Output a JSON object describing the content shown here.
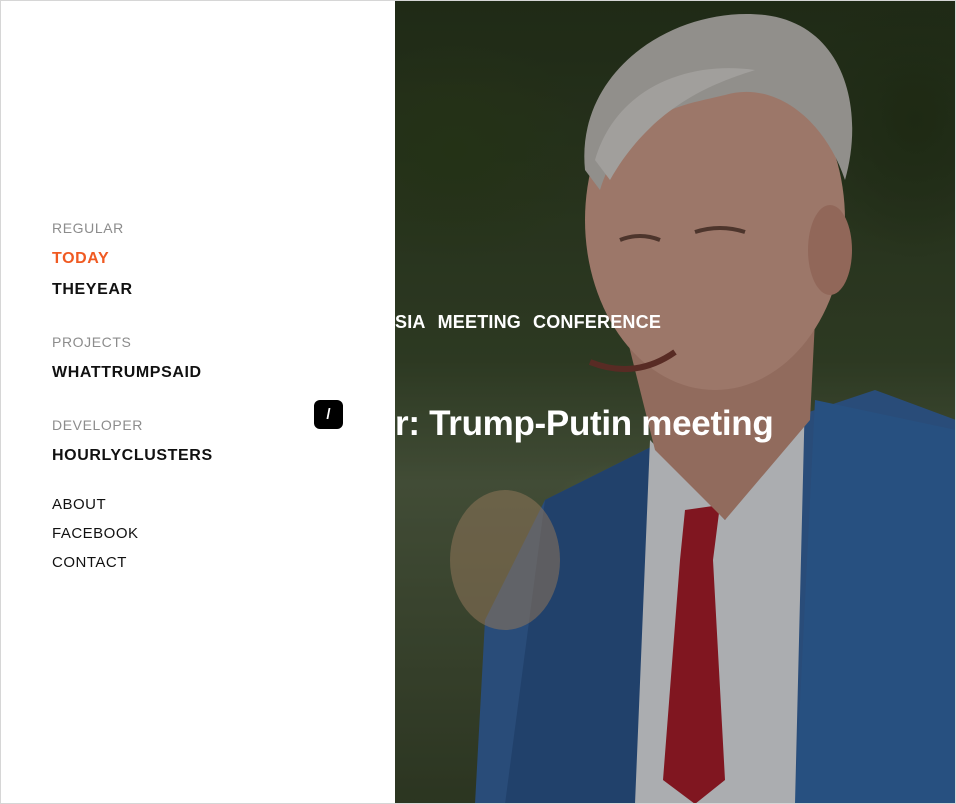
{
  "menu": {
    "regular_label": "REGULAR",
    "today": "TODAY",
    "theyear": "THEYEAR",
    "projects_label": "PROJECTS",
    "whattrumpsaid": "WHATTRUMPSAID",
    "developer_label": "DEVELOPER",
    "hourlyclusters": "HOURLYCLUSTERS",
    "about": "ABOUT",
    "facebook": "FACEBOOK",
    "contact": "CONTACT"
  },
  "toggle_label": "/",
  "article": {
    "tags": [
      "SIA",
      "MEETING",
      "CONFERENCE"
    ],
    "headline": "r: Trump-Putin meeting"
  },
  "colors": {
    "accent": "#f05a22",
    "text": "#111111",
    "muted": "#8c8c8c"
  }
}
